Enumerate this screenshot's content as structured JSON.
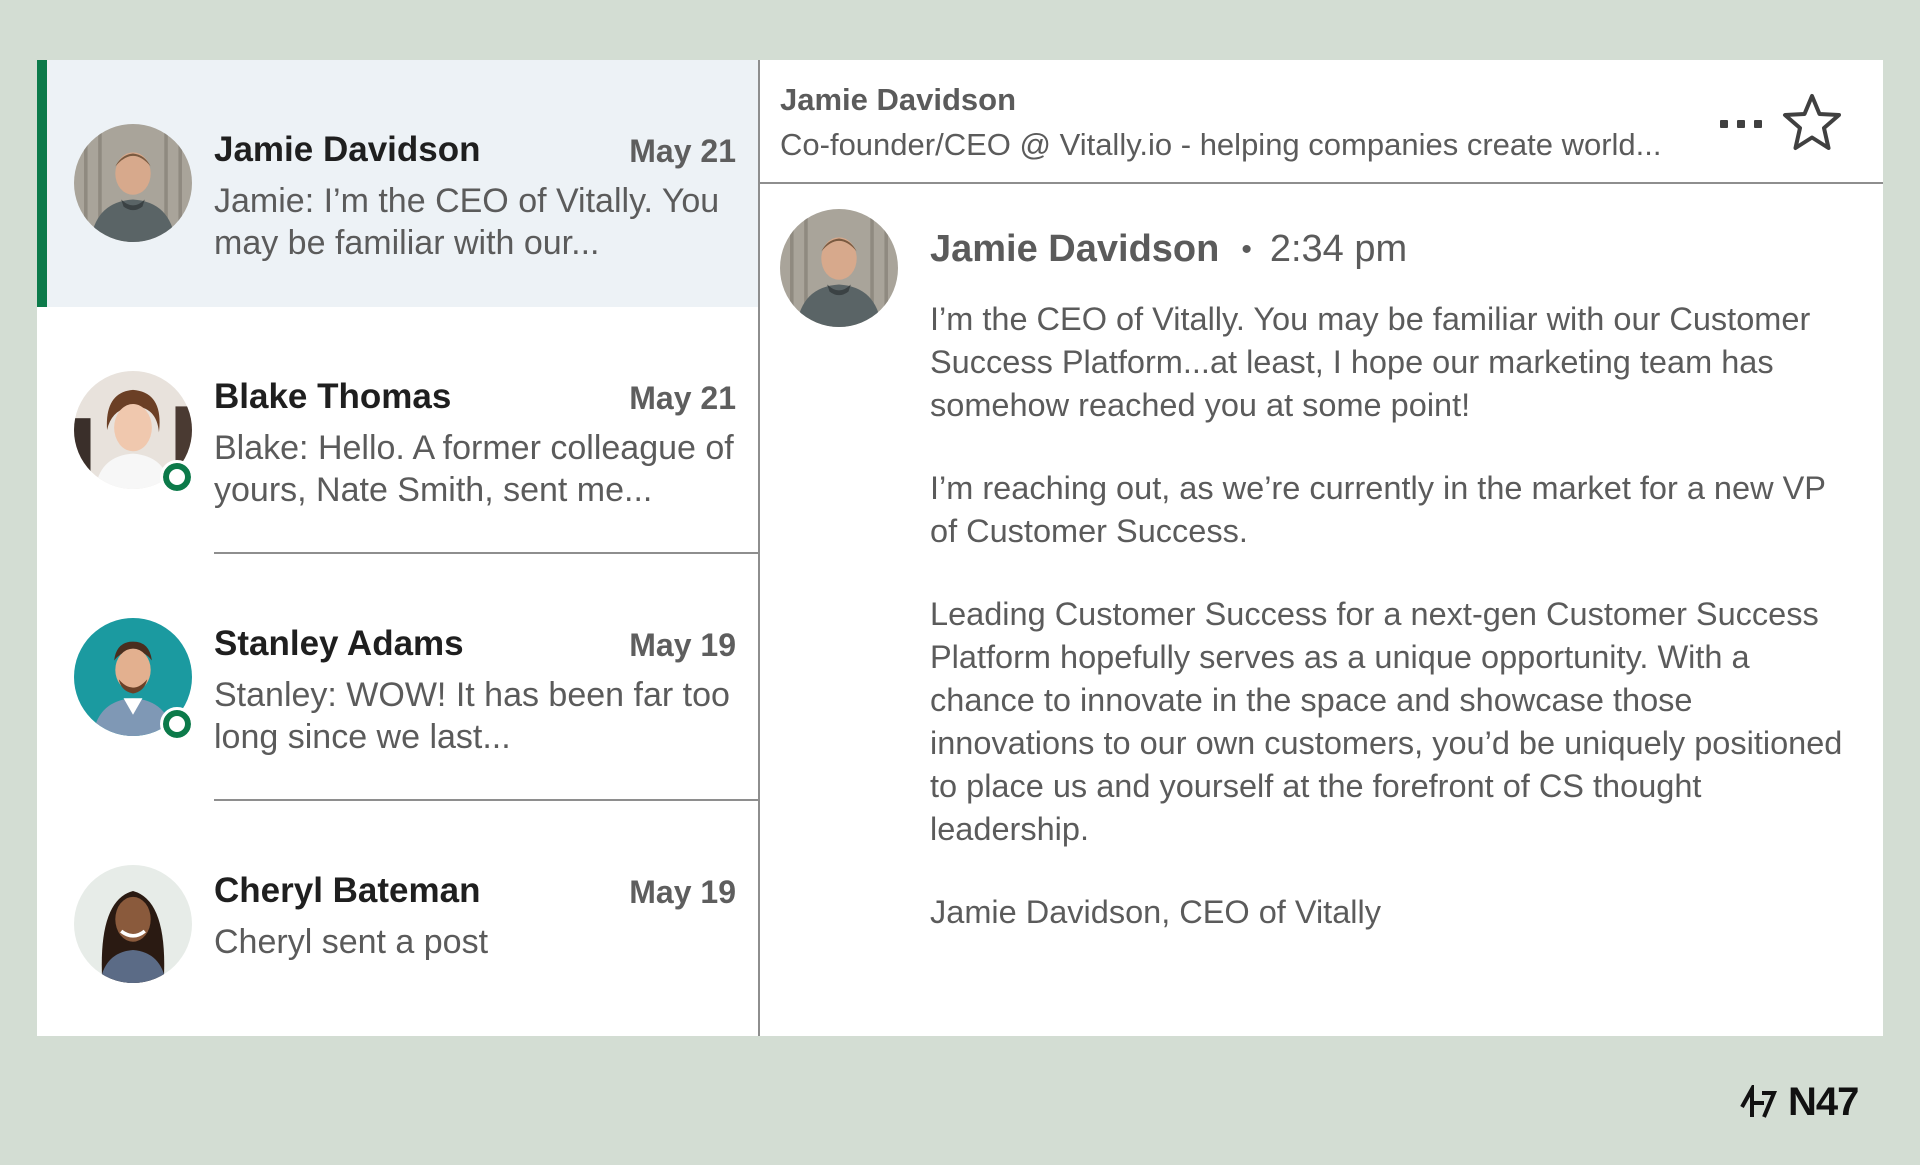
{
  "conversations": [
    {
      "name": "Jamie Davidson",
      "date": "May 21",
      "preview": "Jamie: I’m the CEO of Vitally. You may be familiar with our...",
      "active": true,
      "online": false,
      "avatar_color": "#a9a49a"
    },
    {
      "name": "Blake Thomas",
      "date": "May 21",
      "preview": "Blake: Hello. A former colleague of yours, Nate Smith, sent me...",
      "active": false,
      "online": true,
      "avatar_color": "#e8e2dc"
    },
    {
      "name": "Stanley Adams",
      "date": "May 19",
      "preview": "Stanley: WOW! It has been far too long since we last...",
      "active": false,
      "online": true,
      "avatar_color": "#1b9aa0"
    },
    {
      "name": "Cheryl Bateman",
      "date": "May 19",
      "preview": "Cheryl sent a post",
      "active": false,
      "online": false,
      "avatar_color": "#e7ece8"
    }
  ],
  "thread": {
    "header_name": "Jamie Davidson",
    "header_subtitle": "Co-founder/CEO @ Vitally.io - helping companies create world...",
    "more_icon": "more-horizontal-icon",
    "star_icon": "star-outline-icon",
    "message": {
      "author": "Jamie Davidson",
      "separator": "•",
      "time": "2:34 pm",
      "paragraphs": [
        "I’m the CEO of Vitally. You may be familiar with our Customer Success Platform...at least, I hope our marketing team has somehow reached you at some point!",
        "I’m reaching out, as we’re currently in the market for a new VP of Customer Success.",
        "Leading Customer Success for a next-gen Customer Success Platform hopefully serves as a unique opportunity. With a chance to innovate in the space and showcase those innovations to our own customers, you’d be uniquely positioned to place us and yourself at the forefront of CS thought leadership.",
        "Jamie Davidson, CEO of Vitally"
      ]
    }
  },
  "brand": {
    "text": "N47"
  },
  "colors": {
    "background": "#d3ddd3",
    "accent": "#0c7a4a",
    "active_row": "#edf2f6",
    "text_muted": "#5b5b5b"
  }
}
